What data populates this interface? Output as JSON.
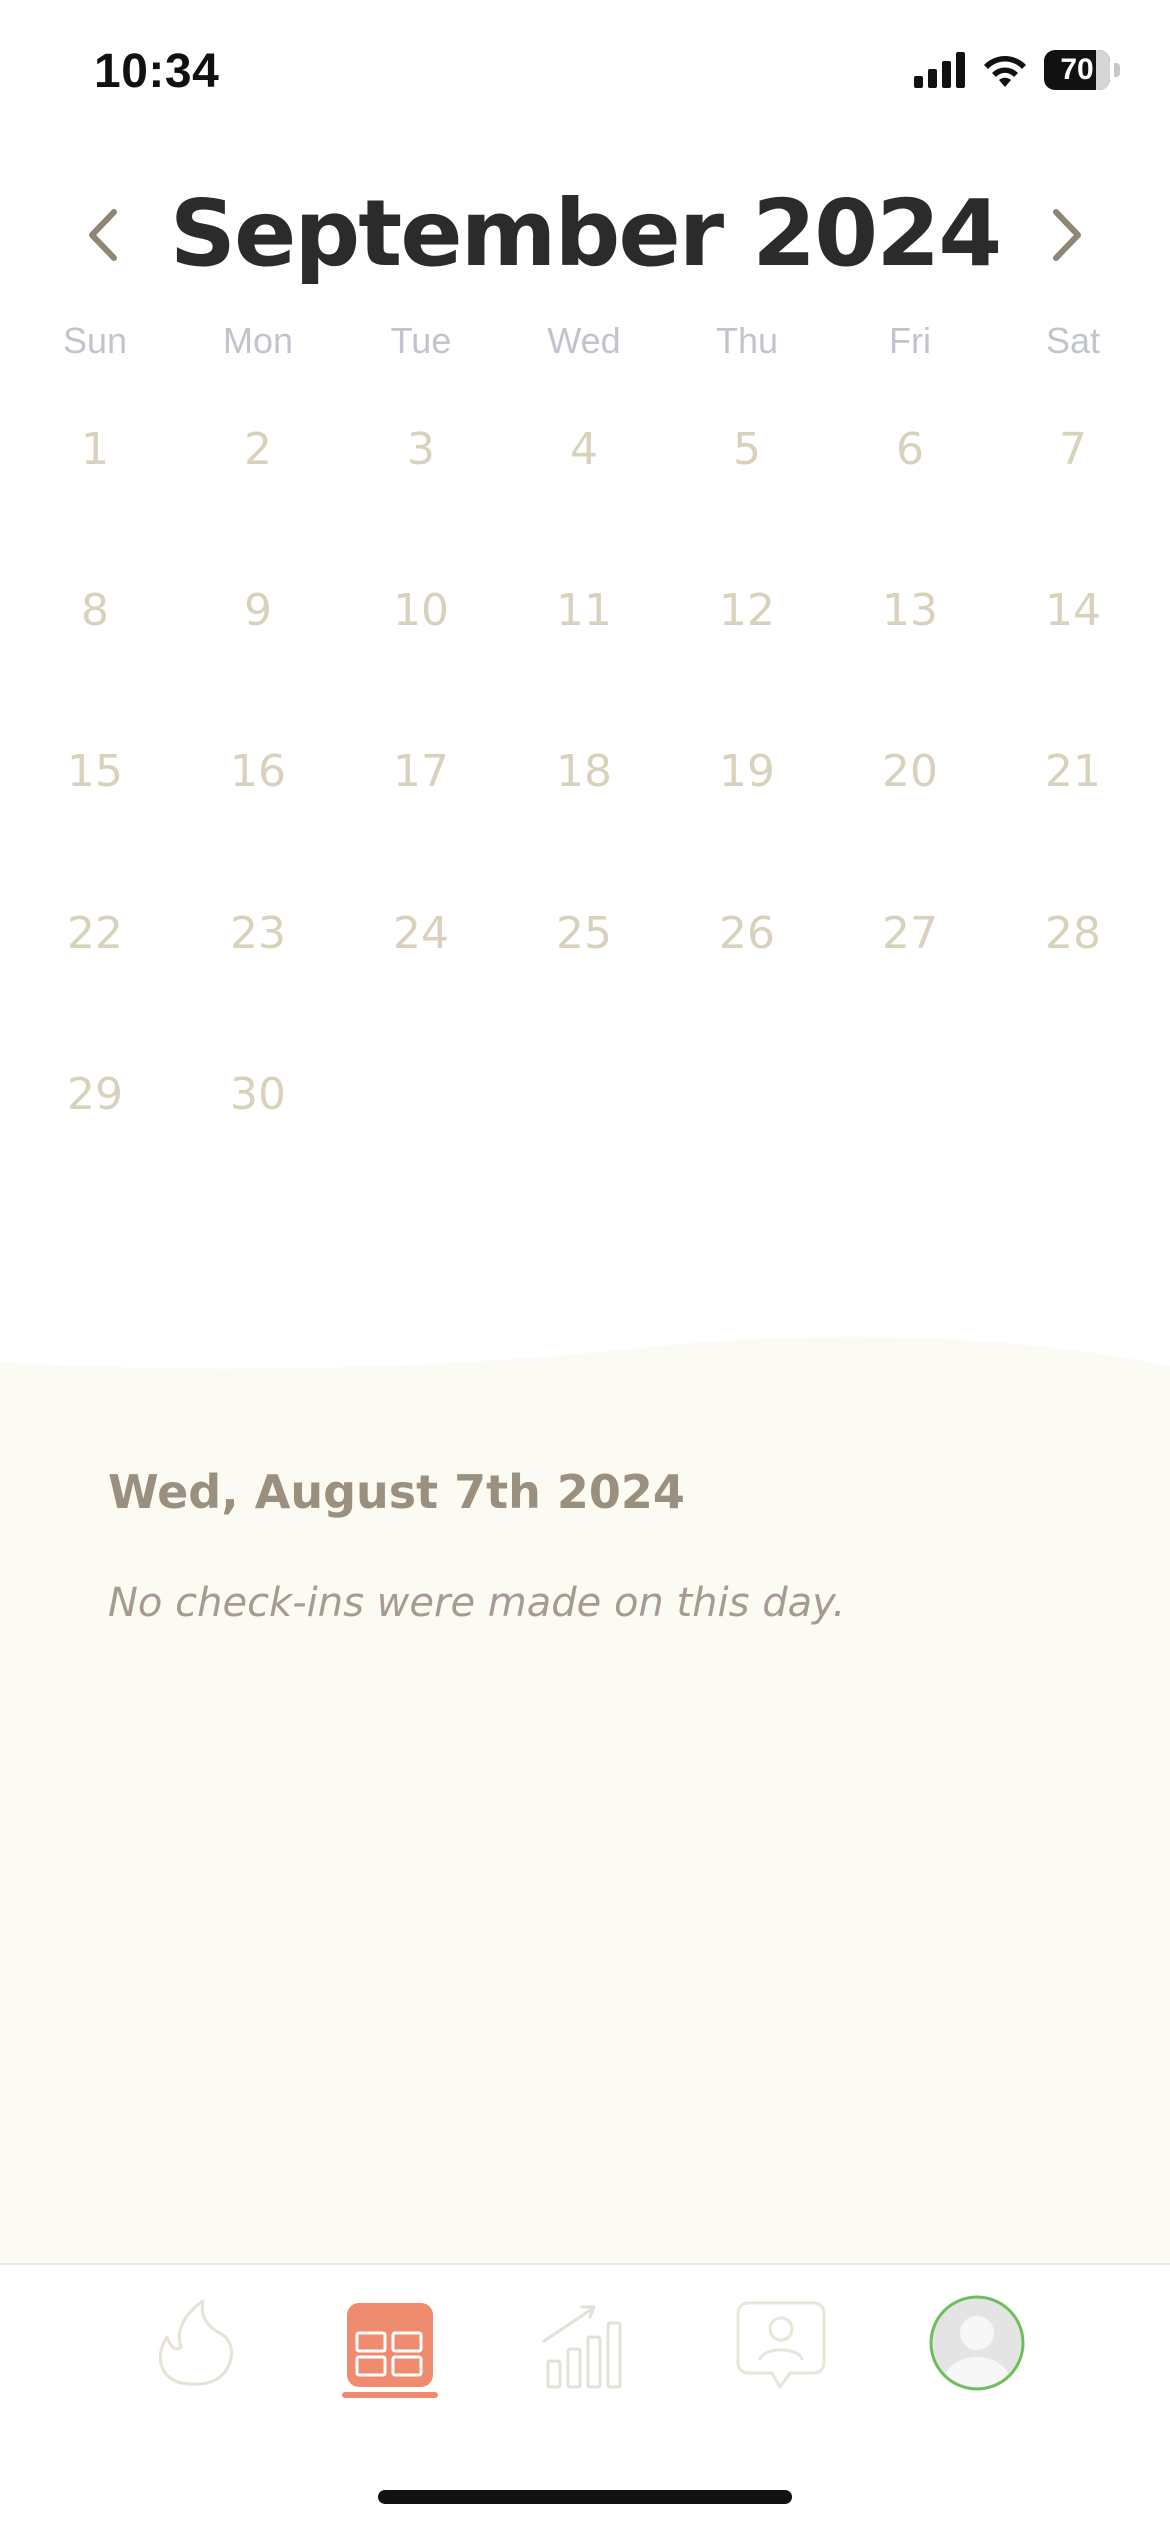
{
  "status_bar": {
    "time": "10:34",
    "battery": "70"
  },
  "calendar": {
    "title": "September 2024",
    "weekdays": [
      "Sun",
      "Mon",
      "Tue",
      "Wed",
      "Thu",
      "Fri",
      "Sat"
    ],
    "days": [
      "1",
      "2",
      "3",
      "4",
      "5",
      "6",
      "7",
      "8",
      "9",
      "10",
      "11",
      "12",
      "13",
      "14",
      "15",
      "16",
      "17",
      "18",
      "19",
      "20",
      "21",
      "22",
      "23",
      "24",
      "25",
      "26",
      "27",
      "28",
      "29",
      "30"
    ]
  },
  "detail": {
    "date_label": "Wed, August 7th 2024",
    "empty_message": "No check-ins were made on this day."
  },
  "tabs": [
    {
      "icon": "flame-icon",
      "active": false
    },
    {
      "icon": "calendar-grid-icon",
      "active": true
    },
    {
      "icon": "progress-chart-icon",
      "active": false
    },
    {
      "icon": "chat-person-icon",
      "active": false
    },
    {
      "icon": "profile-avatar-icon",
      "active": false
    }
  ],
  "colors": {
    "accent": "#ef8b6f",
    "day_text": "#d8d2bd",
    "panel_bg": "#fbfaf3",
    "title": "#2b2b2b"
  }
}
